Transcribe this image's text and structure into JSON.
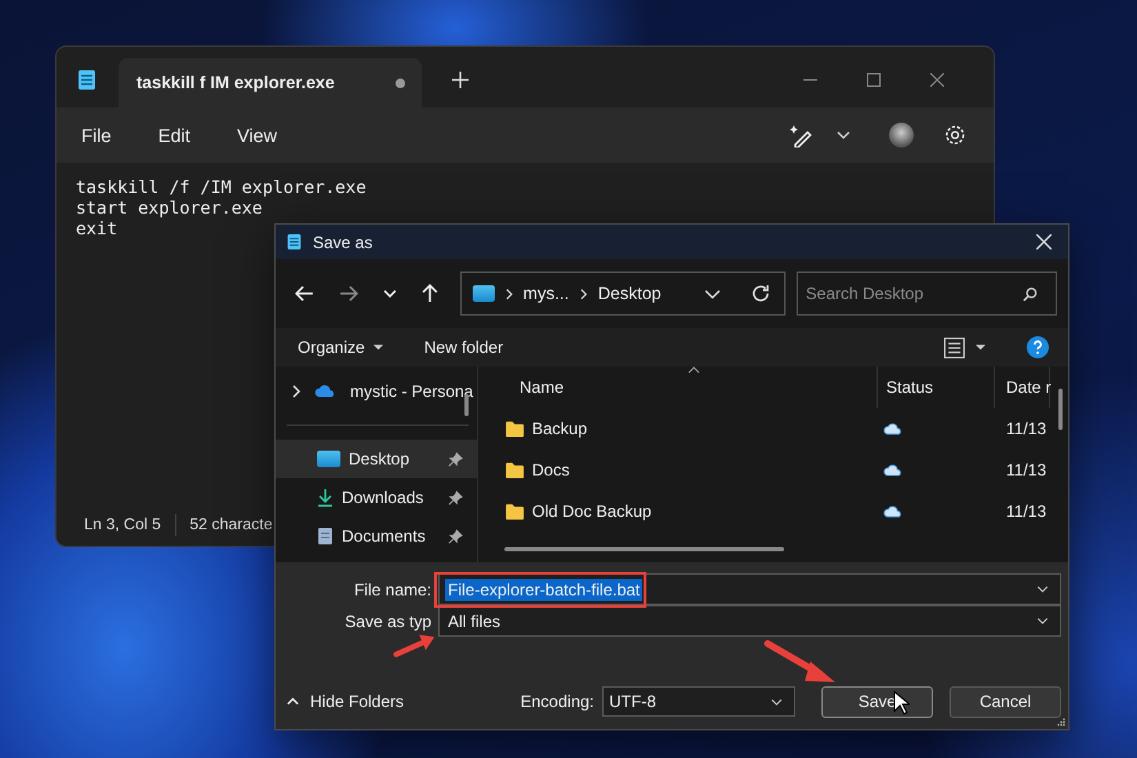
{
  "notepad": {
    "tab_title": "taskkill f IM explorer.exe",
    "unsaved": true,
    "menu": [
      "File",
      "Edit",
      "View"
    ],
    "lines": [
      "taskkill /f /IM explorer.exe",
      "start explorer.exe",
      "exit"
    ],
    "status": [
      "Ln 3, Col 5",
      "52 characte"
    ]
  },
  "dialog": {
    "title": "Save as",
    "breadcrumb": [
      "mys...",
      "Desktop"
    ],
    "search_placeholder": "Search Desktop",
    "toolbar": [
      "Organize",
      "New folder"
    ],
    "nav_items": [
      {
        "kind": "cloud",
        "label": "mystic - Persona",
        "selected": false,
        "pinned": false
      },
      {
        "kind": "desktop",
        "label": "Desktop",
        "selected": true,
        "pinned": true
      },
      {
        "kind": "downloads",
        "label": "Downloads",
        "selected": false,
        "pinned": true
      },
      {
        "kind": "documents",
        "label": "Documents",
        "selected": false,
        "pinned": true
      }
    ],
    "columns": [
      "Name",
      "Status",
      "Date r"
    ],
    "rows": [
      {
        "name": "Backup",
        "date": "11/13"
      },
      {
        "name": "Docs",
        "date": "11/13"
      },
      {
        "name": "Old Doc Backup",
        "date": "11/13"
      }
    ],
    "file_name_label": "File name:",
    "file_name": "File-explorer-batch-file.bat",
    "file_name_selected": true,
    "type_label": "Save as typ",
    "type_value": "All files",
    "hide_folders": "Hide Folders",
    "encoding_label": "Encoding:",
    "encoding": "UTF-8",
    "buttons": [
      "Save",
      "Cancel"
    ]
  }
}
